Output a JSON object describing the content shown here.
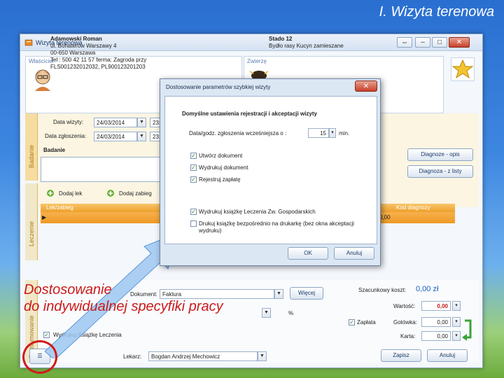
{
  "slide": {
    "title": "I. Wizyta terenowa"
  },
  "window": {
    "title": "Wizyta terenowa",
    "controls": {
      "restore": "⇔",
      "minimize": "–",
      "maximize": "□",
      "close": "✕"
    }
  },
  "owner": {
    "header": "Właściciel",
    "name": "Adamowski Roman",
    "lines": [
      "ul. Bohaterów Warszawy 4",
      "00-650 Warszawa",
      "Tel : 500 42 11 57 ferma: Zagroda przy",
      "FLS001232012032, PL900123201203"
    ]
  },
  "animal": {
    "header": "Zwierzę",
    "name": "Stado 12",
    "line": "Bydło rasy Kucyn zamieszane"
  },
  "tabs": {
    "badanie": "Badanie",
    "leczenie": "Leczenie",
    "podsumowanie": "Podsumowanie"
  },
  "form": {
    "visit_date_label": "Data wizyty:",
    "visit_date": "24/03/2014",
    "visit_time": "23:",
    "report_date_label": "Data zgłoszenia:",
    "report_date": "24/03/2014",
    "report_time": "23:",
    "exam_label": "Badanie",
    "diagnosis_button": "Diagnoze - opis",
    "diagnosis_list_button": "Diagnoza - z listy",
    "add_drug": "Dodaj lek",
    "add_procedure": "Dodaj zabieg",
    "grid_col_left": "Lek/zabieg",
    "grid_col_right": "Kod diagnozy",
    "grid_value": "0,00"
  },
  "bottom": {
    "document_label": "Dokument:",
    "document_value": "Faktura",
    "more_button": "Więcej",
    "percent": "%",
    "print_book_label": "Wydrukuj Książkę Leczenia",
    "estimated_cost_label": "Szacunkowy koszt:",
    "estimated_cost": "0,00 zł",
    "value_label": "Wartość:",
    "value_amount": "0,00",
    "paid_label": "Zapłata",
    "cash_label": "Gotówka:",
    "cash_amount": "0,00",
    "card_label": "Karta:",
    "card_amount": "0,00",
    "doctor_label": "Lekarz:",
    "doctor_value": "Bogdan Andrzej Mechowicz",
    "save_button": "Zapisz",
    "cancel_button": "Anuluj"
  },
  "dialog": {
    "title": "Dostosowanie parametrów szybkiej wizyty",
    "heading": "Domyślne ustawienia rejestracji i akceptacji wizyty",
    "offset_label": "Data/godz. zgłoszenia wcześniejsza o :",
    "offset_value": "15",
    "offset_unit": "min.",
    "checks": [
      {
        "label": "Utwórz dokument",
        "checked": true
      },
      {
        "label": "Wydrukuj dokument",
        "checked": true
      },
      {
        "label": "Rejestruj zapłatę",
        "checked": true
      },
      {
        "label": "Wydrukuj książkę Leczenia Zw. Gospodarskich",
        "checked": true
      },
      {
        "label": "Drukuj książkę bezpośrednio na drukarkę (bez okna akceptacji wydruku)",
        "checked": false
      }
    ],
    "ok_button": "OK",
    "cancel_button": "Anuluj"
  },
  "annotation": {
    "line1": "Dostosowanie",
    "line2": "do indywidualnej specyfiki pracy"
  },
  "colors": {
    "annotation": "#cc1a1a",
    "accent_orange": "#ee9a24",
    "accent_blue": "#2a6fd0"
  }
}
